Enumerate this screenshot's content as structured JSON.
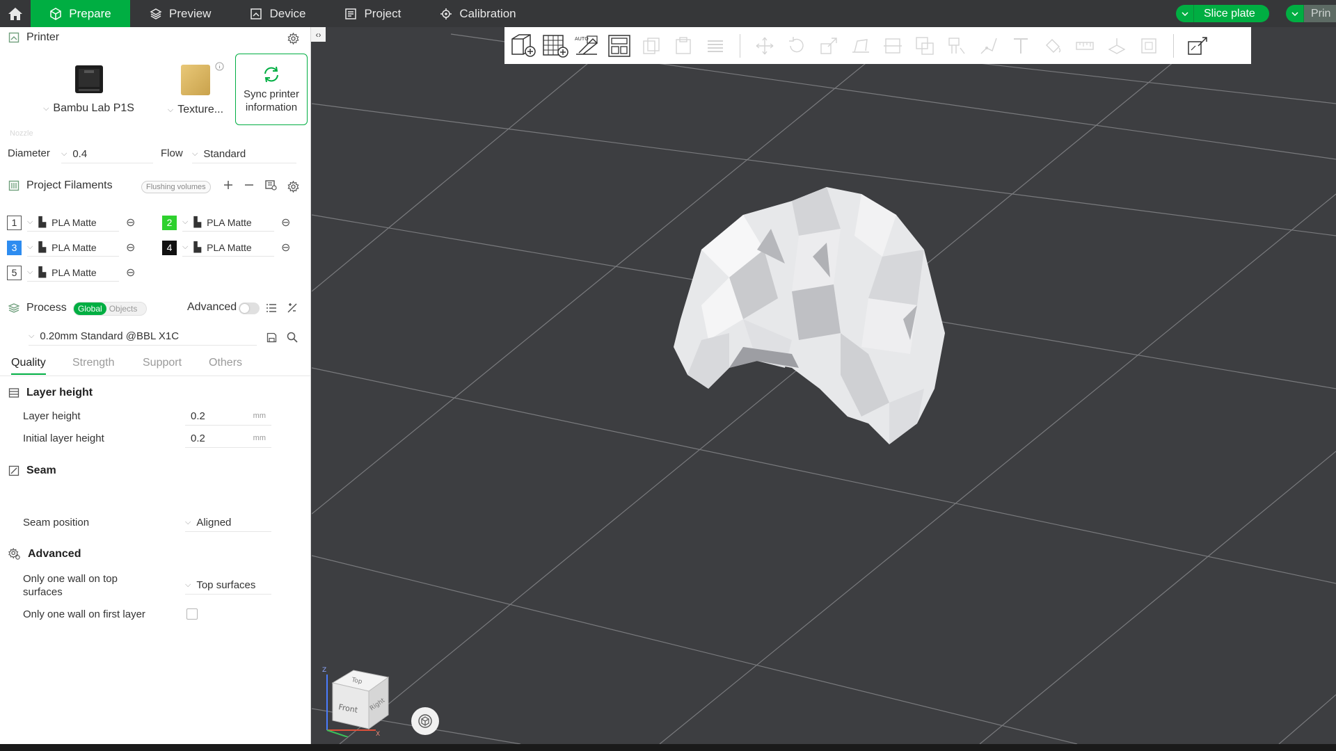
{
  "topbar": {
    "tabs": [
      {
        "label": "Prepare",
        "icon": "cube-icon",
        "active": true
      },
      {
        "label": "Preview",
        "icon": "layers-icon"
      },
      {
        "label": "Device",
        "icon": "device-icon"
      },
      {
        "label": "Project",
        "icon": "project-icon"
      },
      {
        "label": "Calibration",
        "icon": "calibration-icon"
      }
    ],
    "slice_label": "Slice plate",
    "print_label": "Prin",
    "accent_color": "#00ae42"
  },
  "printer": {
    "title": "Printer",
    "model": "Bambu Lab P1S",
    "plate": "Texture...",
    "sync_line1": "Sync printer",
    "sync_line2": "information",
    "nozzle_label": "Nozzle",
    "diameter_label": "Diameter",
    "diameter_value": "0.4",
    "flow_label": "Flow",
    "flow_value": "Standard"
  },
  "filaments": {
    "title": "Project Filaments",
    "flushing_label": "Flushing volumes",
    "items": [
      {
        "num": "1",
        "name": "PLA Matte",
        "color": "#ffffff"
      },
      {
        "num": "2",
        "name": "PLA Matte",
        "color": "#2ed12e"
      },
      {
        "num": "3",
        "name": "PLA Matte",
        "color": "#2d8cf0"
      },
      {
        "num": "4",
        "name": "PLA Matte",
        "color": "#111111"
      },
      {
        "num": "5",
        "name": "PLA Matte",
        "color": "#ffffff"
      }
    ]
  },
  "process": {
    "title": "Process",
    "global_label": "Global",
    "objects_label": "Objects",
    "advanced_label": "Advanced",
    "preset": "0.20mm Standard @BBL X1C",
    "tabs": [
      "Quality",
      "Strength",
      "Support",
      "Others"
    ],
    "layer_group": "Layer height",
    "layer_height_label": "Layer height",
    "layer_height_value": "0.2",
    "initial_layer_label": "Initial layer height",
    "initial_layer_value": "0.2",
    "unit": "mm",
    "seam_group": "Seam",
    "seam_position_label": "Seam position",
    "seam_position_value": "Aligned",
    "advanced_group": "Advanced",
    "one_wall_top_line1": "Only one wall on top",
    "one_wall_top_line2": "surfaces",
    "one_wall_top_value": "Top surfaces",
    "one_wall_first_label": "Only one wall on first layer"
  },
  "viewport": {
    "cube_top": "Top",
    "cube_front": "Front",
    "cube_right": "Right",
    "axis_x": "X",
    "axis_z": "Z"
  }
}
